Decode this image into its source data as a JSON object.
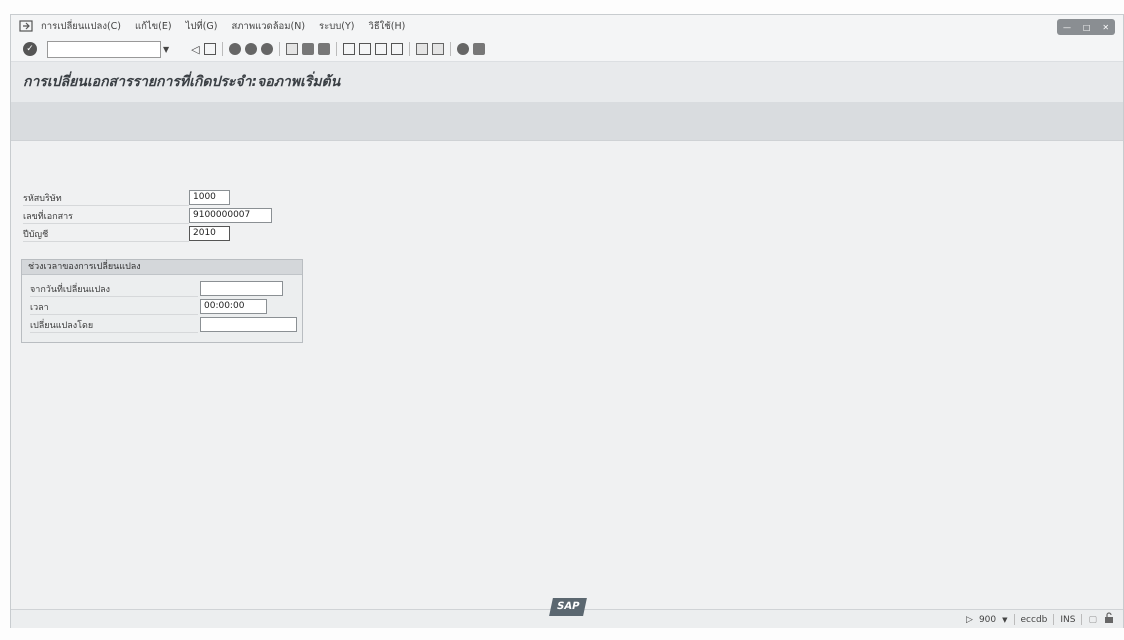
{
  "menubar": {
    "items": [
      {
        "label": "การเปลี่ยนแปลง(C)"
      },
      {
        "label": "แก้ไข(E)"
      },
      {
        "label": "ไปที่(G)"
      },
      {
        "label": "สภาพแวดล้อม(N)"
      },
      {
        "label": "ระบบ(Y)"
      },
      {
        "label": "วิธีใช้(H)"
      }
    ]
  },
  "toolbar": {
    "command_field": ""
  },
  "title": "การเปลี่ยนเอกสารรายการที่เกิดประจำ:จอภาพเริ่มต้น",
  "form": {
    "company_code_label": "รหัสบริษัท",
    "company_code_value": "1000",
    "doc_number_label": "เลขที่เอกสาร",
    "doc_number_value": "9100000007",
    "fiscal_year_label": "ปีบัญชี",
    "fiscal_year_value": "2010"
  },
  "group": {
    "title": "ช่วงเวลาของการเปลี่ยนแปลง",
    "from_date_label": "จากวันที่เปลี่ยนแปลง",
    "from_date_value": "",
    "time_label": "เวลา",
    "time_value": "00:00:00",
    "changed_by_label": "เปลี่ยนแปลงโดย",
    "changed_by_value": ""
  },
  "status": {
    "logo": "SAP",
    "client": "900",
    "server": "eccdb",
    "mode": "INS"
  }
}
